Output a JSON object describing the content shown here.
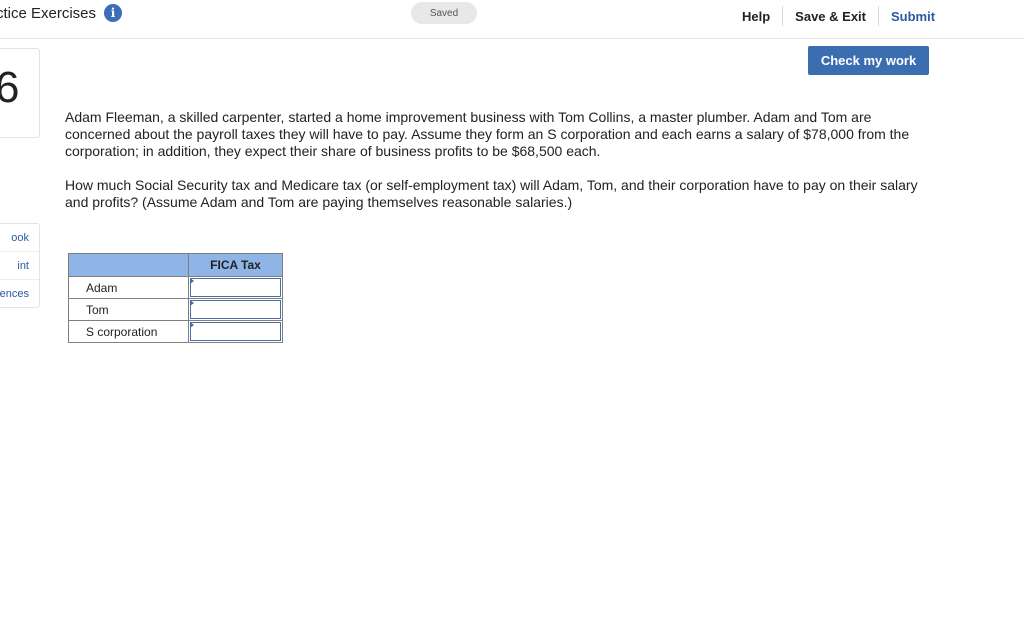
{
  "header": {
    "title": "ctice Exercises",
    "info_icon": "info-icon",
    "saved_label": "Saved",
    "help_label": "Help",
    "save_exit_label": "Save & Exit",
    "submit_label": "Submit"
  },
  "question": {
    "number": "6",
    "paragraph1": "Adam Fleeman, a skilled carpenter, started a home improvement business with Tom Collins, a master plumber. Adam and Tom are concerned about the payroll taxes they will have to pay. Assume they form an S corporation and each earns a salary of $78,000 from the corporation; in addition, they expect their share of business profits to be $68,500 each.",
    "paragraph2": "How much Social Security tax and Medicare tax (or self-employment tax) will Adam, Tom, and their corporation have to pay on their salary and profits? (Assume Adam and Tom are paying themselves reasonable salaries.)"
  },
  "check_button_label": "Check my work",
  "side_menu": {
    "items": [
      {
        "label": "ook"
      },
      {
        "label": "int"
      },
      {
        "label": "ences"
      }
    ]
  },
  "table": {
    "header": "FICA Tax",
    "rows": [
      {
        "label": "Adam",
        "value": ""
      },
      {
        "label": "Tom",
        "value": ""
      },
      {
        "label": "S corporation",
        "value": ""
      }
    ]
  },
  "colors": {
    "accent": "#3b6eb0",
    "table_header": "#8fb4e6"
  }
}
